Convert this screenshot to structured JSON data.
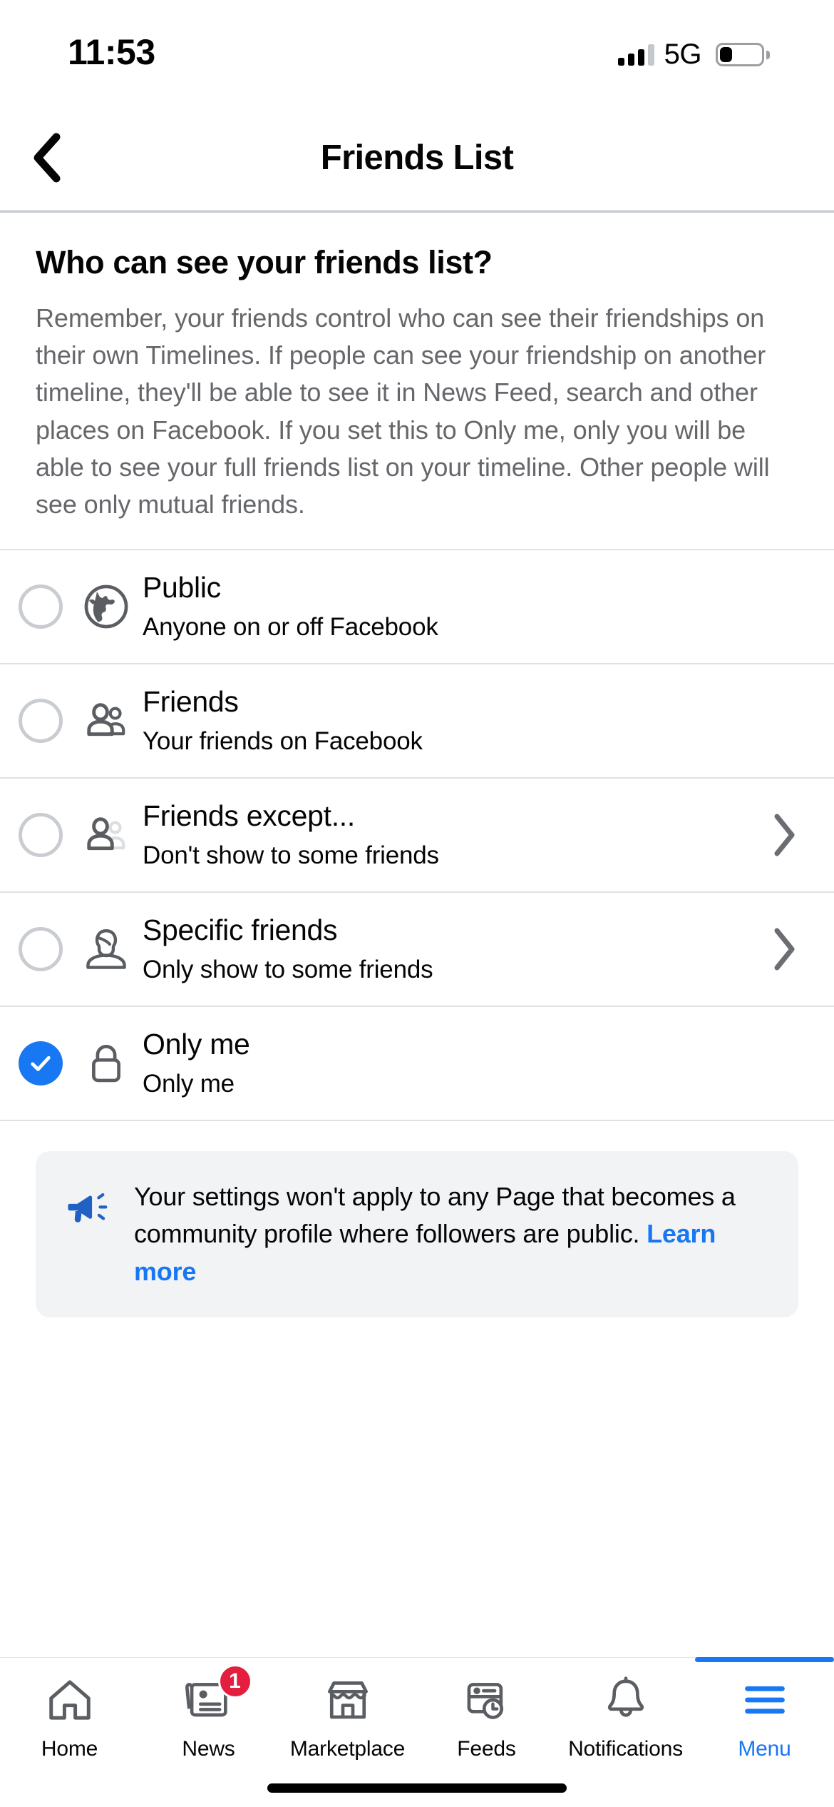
{
  "status_bar": {
    "time": "11:53",
    "network": "5G",
    "signal_bars_filled": 3,
    "signal_bars_total": 4,
    "battery_percent": 30
  },
  "header": {
    "title": "Friends List",
    "back_icon": "chevron-left-icon"
  },
  "intro": {
    "title": "Who can see your friends list?",
    "body": "Remember, your friends control who can see their friendships on their own Timelines. If people can see your friendship on another timeline, they'll be able to see it in News Feed, search and other places on Facebook. If you set this to Only me, only you will be able to see your full friends list on your timeline. Other people will see only mutual friends."
  },
  "options": [
    {
      "label": "Public",
      "sublabel": "Anyone on or off Facebook",
      "icon": "globe-icon",
      "selected": false,
      "has_chevron": false
    },
    {
      "label": "Friends",
      "sublabel": "Your friends on Facebook",
      "icon": "two-people-icon",
      "selected": false,
      "has_chevron": false
    },
    {
      "label": "Friends except...",
      "sublabel": "Don't show to some friends",
      "icon": "two-people-faded-icon",
      "selected": false,
      "has_chevron": true
    },
    {
      "label": "Specific friends",
      "sublabel": "Only show to some friends",
      "icon": "person-icon",
      "selected": false,
      "has_chevron": true
    },
    {
      "label": "Only me",
      "sublabel": "Only me",
      "icon": "lock-icon",
      "selected": true,
      "has_chevron": false
    }
  ],
  "banner": {
    "icon": "megaphone-icon",
    "text": "Your settings won't apply to any Page that becomes a community profile where followers are public. ",
    "link_label": "Learn more"
  },
  "tabbar": [
    {
      "label": "Home",
      "icon": "home-icon",
      "active": false,
      "badge": null
    },
    {
      "label": "News",
      "icon": "news-icon",
      "active": false,
      "badge": "1"
    },
    {
      "label": "Marketplace",
      "icon": "store-icon",
      "active": false,
      "badge": null
    },
    {
      "label": "Feeds",
      "icon": "feeds-icon",
      "active": false,
      "badge": null
    },
    {
      "label": "Notifications",
      "icon": "bell-icon",
      "active": false,
      "badge": null
    },
    {
      "label": "Menu",
      "icon": "hamburger-icon",
      "active": true,
      "badge": null
    }
  ],
  "colors": {
    "accent_blue": "#1877f2",
    "badge_red": "#e41e3f",
    "secondary_text": "#65676b",
    "banner_bg": "#f2f3f5"
  }
}
